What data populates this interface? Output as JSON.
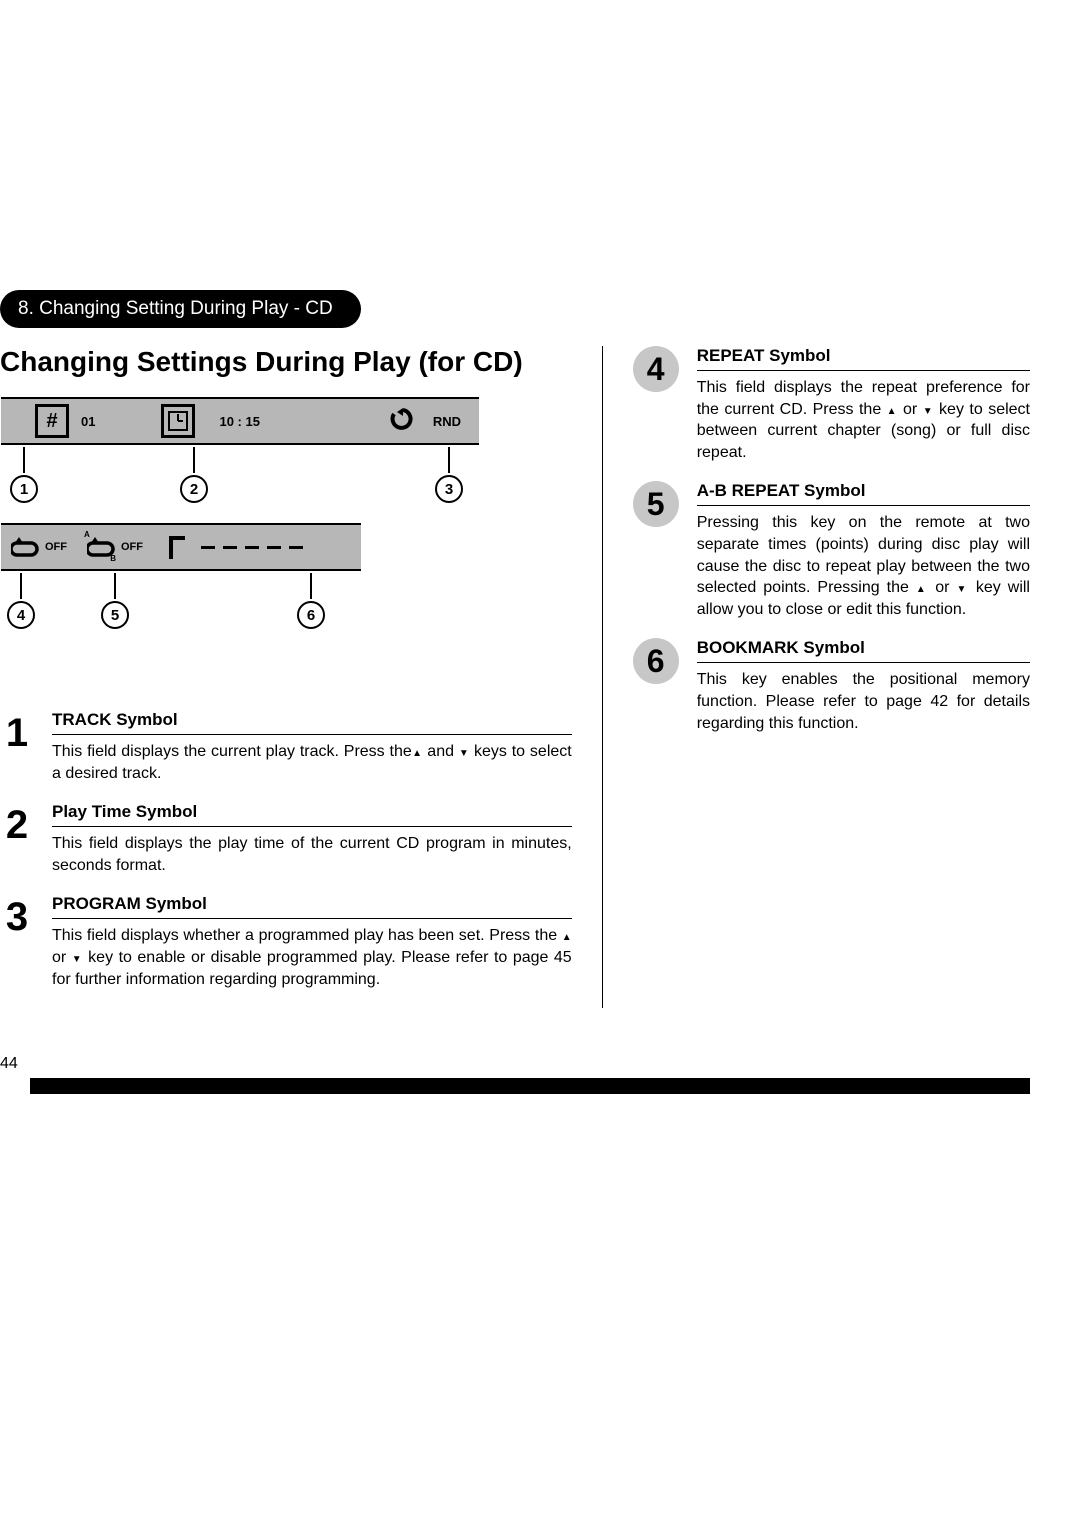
{
  "section_pill": "8. Changing Setting During Play - CD",
  "main_title": "Changing Settings During Play (for CD)",
  "display1": {
    "track": "01",
    "time": "10 : 15",
    "mode": "RND"
  },
  "display2": {
    "repeat": "OFF",
    "abrepeat": "OFF",
    "bookmarks": "— — — — —"
  },
  "callouts": [
    "1",
    "2",
    "3",
    "4",
    "5",
    "6"
  ],
  "left_items": [
    {
      "num": "1",
      "title": "TRACK Symbol",
      "text_a": "This field displays the current play track. Press the",
      "text_b": " and ",
      "text_c": " keys to select a desired track."
    },
    {
      "num": "2",
      "title": "Play Time Symbol",
      "text_a": "This field displays the play time of the current CD program in minutes, seconds format.",
      "text_b": "",
      "text_c": ""
    },
    {
      "num": "3",
      "title": "PROGRAM Symbol",
      "text_a": "This field displays whether a programmed play has been set. Press the ",
      "text_b": " or ",
      "text_c": " key to enable or disable programmed play. Please refer to page 45 for further information regarding programming."
    }
  ],
  "right_items": [
    {
      "num": "4",
      "title": "REPEAT Symbol",
      "text_a": "This field displays the repeat preference for the current CD. Press the ",
      "text_b": " or ",
      "text_c": " key to select between current chapter (song) or  full disc repeat."
    },
    {
      "num": "5",
      "title": "A-B REPEAT Symbol",
      "text_a": "Pressing this key on the remote at two separate times (points) during disc play will cause the disc to repeat play between the two selected points. Pressing the ",
      "text_b": " or ",
      "text_c": " key will allow you to close or edit this function."
    },
    {
      "num": "6",
      "title": "BOOKMARK Symbol",
      "text_a": "This key enables the positional memory function. Please refer to page 42 for details regarding this function.",
      "text_b": "",
      "text_c": ""
    }
  ],
  "page_number": "44"
}
